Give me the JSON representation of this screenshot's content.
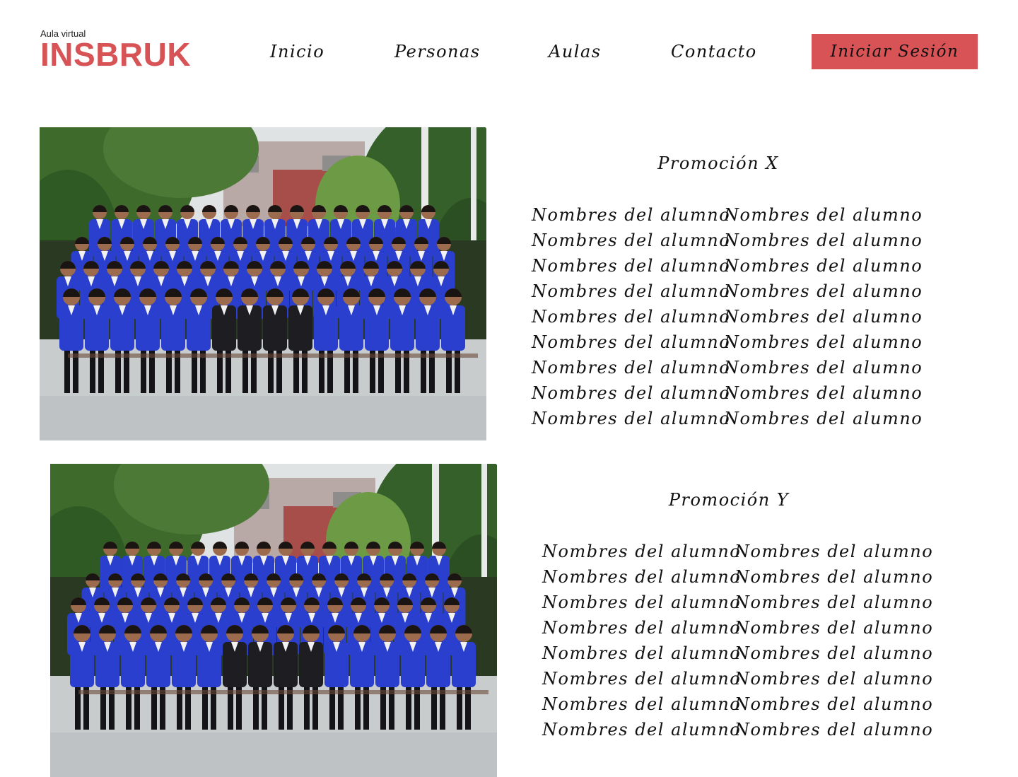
{
  "header": {
    "brand_subtitle": "Aula virtual",
    "brand_name": "INSBRUK",
    "nav": {
      "inicio": "Inicio",
      "personas": "Personas",
      "aulas": "Aulas",
      "contacto": "Contacto"
    },
    "login_label": "Iniciar Sesión"
  },
  "colors": {
    "accent": "#d75356",
    "uniform": "#2b3fcf"
  },
  "sections": [
    {
      "title": "Promoción X",
      "photo_icon": "class-group-photo",
      "names": [
        "Nombres del alumno",
        "Nombres del alumno",
        "Nombres del alumno",
        "Nombres del alumno",
        "Nombres del alumno",
        "Nombres del alumno",
        "Nombres del alumno",
        "Nombres del alumno",
        "Nombres del alumno",
        "Nombres del alumno",
        "Nombres del alumno",
        "Nombres del alumno",
        "Nombres del alumno",
        "Nombres del alumno",
        "Nombres del alumno",
        "Nombres del alumno",
        "Nombres del alumno",
        "Nombres del alumno"
      ]
    },
    {
      "title": "Promoción Y",
      "photo_icon": "class-group-photo",
      "names": [
        "Nombres del alumno",
        "Nombres del alumno",
        "Nombres del alumno",
        "Nombres del alumno",
        "Nombres del alumno",
        "Nombres del alumno",
        "Nombres del alumno",
        "Nombres del alumno",
        "Nombres del alumno",
        "Nombres del alumno",
        "Nombres del alumno",
        "Nombres del alumno",
        "Nombres del alumno",
        "Nombres del alumno",
        "Nombres del alumno",
        "Nombres del alumno"
      ]
    }
  ]
}
